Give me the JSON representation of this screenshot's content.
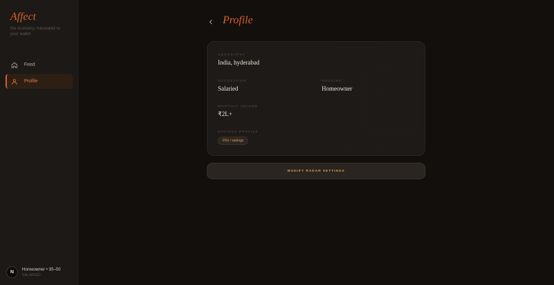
{
  "sidebar": {
    "brand": "Affect",
    "tagline": "the economy, translated to your wallet",
    "items": [
      {
        "label": "Feed",
        "icon": "home-icon"
      },
      {
        "label": "Profile",
        "icon": "user-icon",
        "active": true
      }
    ],
    "user": {
      "avatar_initial": "N",
      "primary": "Homeowner • 35–50",
      "secondary": "SALARIED"
    }
  },
  "header": {
    "back_icon": "chevron-left-icon",
    "title": "Profile"
  },
  "profile": {
    "geography": {
      "label": "GEOGRAPHY",
      "value": "India, hyderabad"
    },
    "occupation": {
      "label": "OCCUPATION",
      "value": "Salaried"
    },
    "housing": {
      "label": "HOUSING",
      "value": "Homeowner"
    },
    "monthly_income": {
      "label": "MONTHLY INCOME",
      "value": "₹2L+"
    },
    "savings_profile": {
      "label": "SAVINGS PROFILE",
      "badge": "FDs / savings"
    }
  },
  "actions": {
    "radar_button": "MODIFY RADAR SETTINGS"
  },
  "colors": {
    "accent": "#d9602a",
    "gold": "#e0a25c",
    "background": "#130f0c",
    "sidebar": "#1c1916",
    "card": "#1e1a17"
  }
}
